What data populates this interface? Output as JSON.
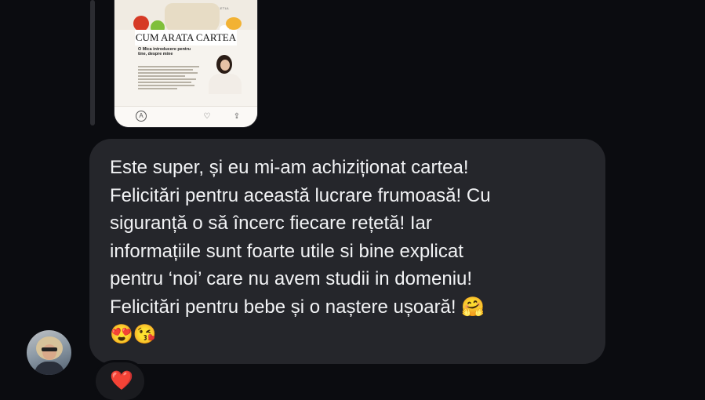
{
  "attachment": {
    "header_text": "CORPUL MINTEA SI SUFLETUL",
    "title": "CUM ARATA CARTEA",
    "subtitle": "O Mica introducere pentru tine, despre mine"
  },
  "message": {
    "lines": [
      "Este super, și eu mi-am achiziționat cartea!",
      "Felicitări pentru această lucrare frumoasă! Cu",
      "siguranță o să încerc fiecare rețetă! Iar",
      "informațiile sunt foarte utile si bine explicat",
      "pentru ‘noi’ care nu avem studii in domeniu!",
      "Felicitări pentru bebe și o naștere ușoară! 🤗",
      "😍😘"
    ]
  },
  "reaction": {
    "emoji": "❤️",
    "color": "#e0152b"
  },
  "colors": {
    "background": "#0b0c10",
    "bubble": "#25262b",
    "text": "#f2f3f5"
  },
  "icons": [
    "a-circle-icon",
    "heart-icon",
    "share-icon",
    "heart-reaction-icon"
  ]
}
